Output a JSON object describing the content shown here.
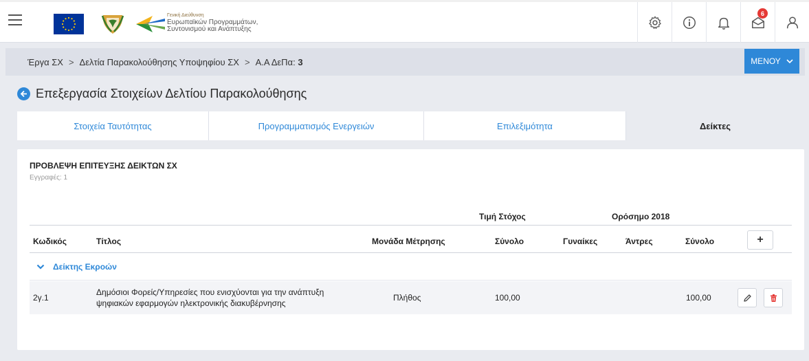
{
  "header": {
    "brand_small": "Γενική Διεύθυνση",
    "brand_line1": "Ευρωπαϊκών Προγραμμάτων,",
    "brand_line2": "Συντονισμού και Ανάπτυξης",
    "notification_count": "6",
    "colors": {
      "accent": "#2e88d8",
      "badge": "#e53935",
      "eu_blue": "#003399",
      "eu_star": "#ffcc00"
    }
  },
  "breadcrumb": {
    "item1": "Έργα ΣΧ",
    "item2": "Δελτία Παρακολούθησης Υποψηφίου ΣΧ",
    "item3_label": "Α.Α ΔεΠα:",
    "item3_value": "3",
    "separator": ">"
  },
  "menu_button": {
    "label": "ΜΕΝΟΥ"
  },
  "page": {
    "title": "Επεξεργασία Στοιχείων Δελτίου Παρακολούθησης"
  },
  "tabs": [
    {
      "label": "Στοιχεία Ταυτότητας"
    },
    {
      "label": "Προγραμματισμός Ενεργειών"
    },
    {
      "label": "Επιλεξιμότητα"
    },
    {
      "label": "Δείκτες"
    }
  ],
  "panel": {
    "title": "ΠΡΟΒΛΕΨΗ ΕΠΙΤΕΥΞΗΣ ΔΕΙΚΤΩΝ ΣΧ",
    "records": "Εγγραφές: 1",
    "group_headers": {
      "target": "Τιμή Στόχος",
      "milestone": "Ορόσημο 2018"
    },
    "columns": {
      "code": "Κωδικός",
      "title": "Τίτλος",
      "unit": "Μονάδα Μέτρησης",
      "target_total": "Σύνολο",
      "women": "Γυναίκες",
      "men": "Άντρες",
      "milestone_total": "Σύνολο"
    },
    "add_label": "+",
    "group": "Δείκτης Εκροών",
    "row": {
      "code": "2γ.1",
      "title_line1": "Δημόσιοι Φορείς/Υπηρεσίες που ενισχύονται για την ανάπτυξη",
      "title_line2": "ψηφιακών εφαρμογών ηλεκτρονικής διακυβέρνησης",
      "unit": "Πλήθος",
      "target_total": "100,00",
      "milestone_total": "100,00"
    }
  }
}
